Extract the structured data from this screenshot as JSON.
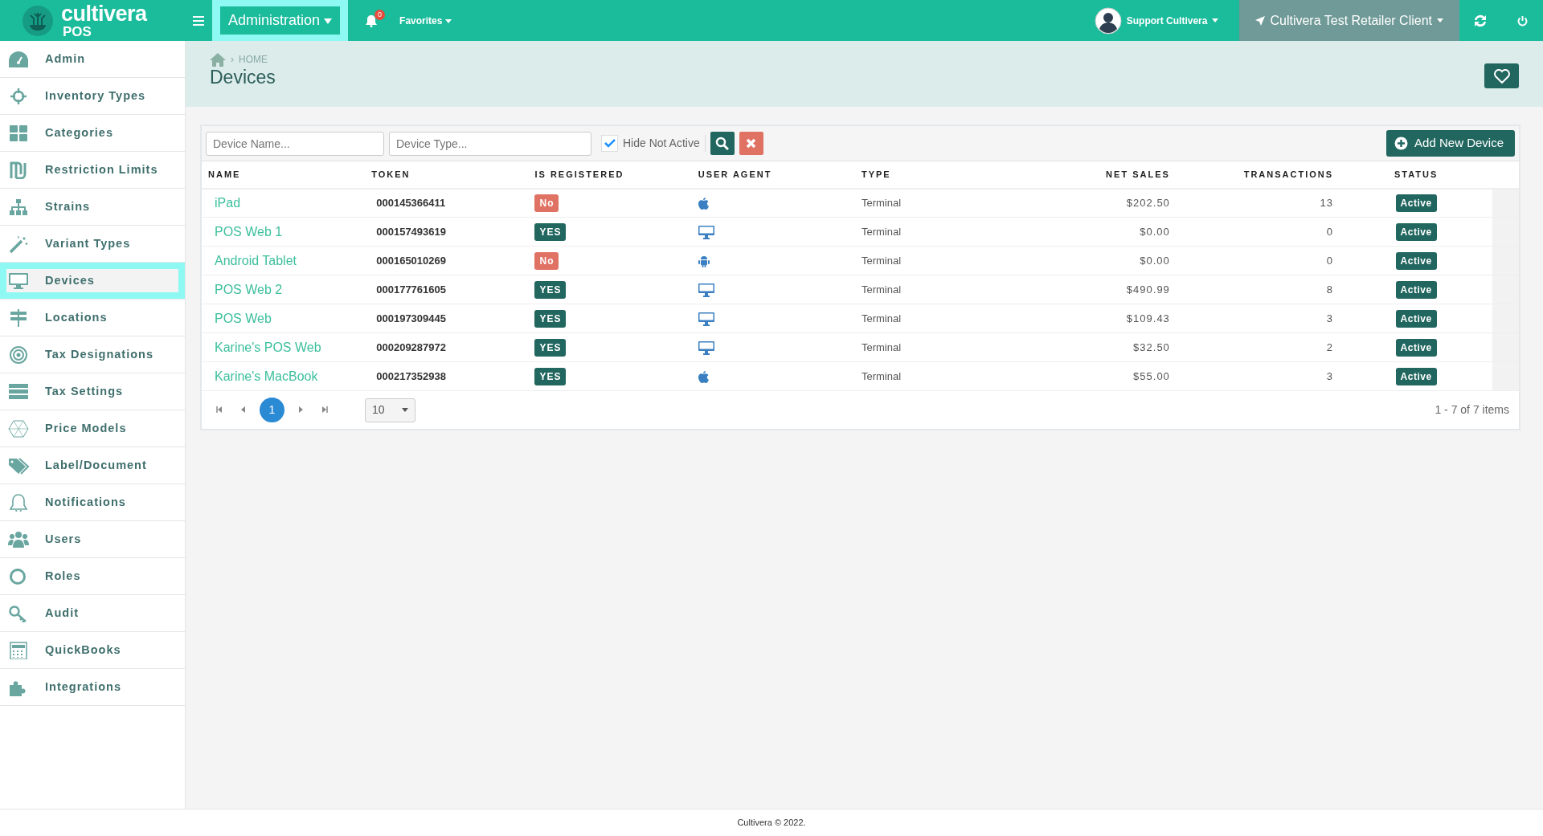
{
  "topbar": {
    "brand_name": "cultivera",
    "brand_sub": "POS",
    "module_menu": "Administration",
    "notification_count": "0",
    "favorites": "Favorites",
    "user": "Support Cultivera",
    "client": "Cultivera Test Retailer Client"
  },
  "sidebar": {
    "items": [
      {
        "label": "Admin",
        "selected": false
      },
      {
        "label": "Inventory Types",
        "selected": false
      },
      {
        "label": "Categories",
        "selected": false
      },
      {
        "label": "Restriction Limits",
        "selected": false
      },
      {
        "label": "Strains",
        "selected": false
      },
      {
        "label": "Variant Types",
        "selected": false
      },
      {
        "label": "Devices",
        "selected": true
      },
      {
        "label": "Locations",
        "selected": false
      },
      {
        "label": "Tax Designations",
        "selected": false
      },
      {
        "label": "Tax Settings",
        "selected": false
      },
      {
        "label": "Price Models",
        "selected": false
      },
      {
        "label": "Label/Document",
        "selected": false
      },
      {
        "label": "Notifications",
        "selected": false
      },
      {
        "label": "Users",
        "selected": false
      },
      {
        "label": "Roles",
        "selected": false
      },
      {
        "label": "Audit",
        "selected": false
      },
      {
        "label": "QuickBooks",
        "selected": false
      },
      {
        "label": "Integrations",
        "selected": false
      }
    ]
  },
  "page_header": {
    "separator": "›",
    "breadcrumb": "HOME",
    "title": "Devices"
  },
  "toolbar": {
    "name_filter": {
      "placeholder": "Device Name..."
    },
    "type_filter": {
      "placeholder": "Device Type..."
    },
    "hide_not_active": {
      "label": "Hide Not Active",
      "checked": true
    },
    "add_button": "Add New Device"
  },
  "table": {
    "columns": [
      "NAME",
      "TOKEN",
      "IS REGISTERED",
      "USER AGENT",
      "TYPE",
      "NET SALES",
      "TRANSACTIONS",
      "STATUS"
    ],
    "rows": [
      {
        "name": "iPad",
        "token": "000145366411",
        "registered": false,
        "registered_label": "No",
        "user_agent": {
          "kind": "apple"
        },
        "type": "Terminal",
        "net_sales": "$202.50",
        "transactions": "13",
        "status": "Active"
      },
      {
        "name": "POS Web 1",
        "token": "000157493619",
        "registered": true,
        "registered_label": "YES",
        "user_agent": {
          "kind": "desktop"
        },
        "type": "Terminal",
        "net_sales": "$0.00",
        "transactions": "0",
        "status": "Active"
      },
      {
        "name": "Android Tablet",
        "token": "000165010269",
        "registered": false,
        "registered_label": "No",
        "user_agent": {
          "kind": "android"
        },
        "type": "Terminal",
        "net_sales": "$0.00",
        "transactions": "0",
        "status": "Active"
      },
      {
        "name": "POS Web 2",
        "token": "000177761605",
        "registered": true,
        "registered_label": "YES",
        "user_agent": {
          "kind": "desktop"
        },
        "type": "Terminal",
        "net_sales": "$490.99",
        "transactions": "8",
        "status": "Active"
      },
      {
        "name": "POS Web",
        "token": "000197309445",
        "registered": true,
        "registered_label": "YES",
        "user_agent": {
          "kind": "desktop"
        },
        "type": "Terminal",
        "net_sales": "$109.43",
        "transactions": "3",
        "status": "Active"
      },
      {
        "name": "Karine's POS Web",
        "token": "000209287972",
        "registered": true,
        "registered_label": "YES",
        "user_agent": {
          "kind": "desktop"
        },
        "type": "Terminal",
        "net_sales": "$32.50",
        "transactions": "2",
        "status": "Active"
      },
      {
        "name": "Karine's MacBook",
        "token": "000217352938",
        "registered": true,
        "registered_label": "YES",
        "user_agent": {
          "kind": "apple"
        },
        "type": "Terminal",
        "net_sales": "$55.00",
        "transactions": "3",
        "status": "Active"
      }
    ]
  },
  "pager": {
    "pages": [
      {
        "label": "1",
        "selected": true
      }
    ],
    "page_size": "10",
    "summary": "1 - 7 of 7 items"
  },
  "footer": "Cultivera © 2022."
}
